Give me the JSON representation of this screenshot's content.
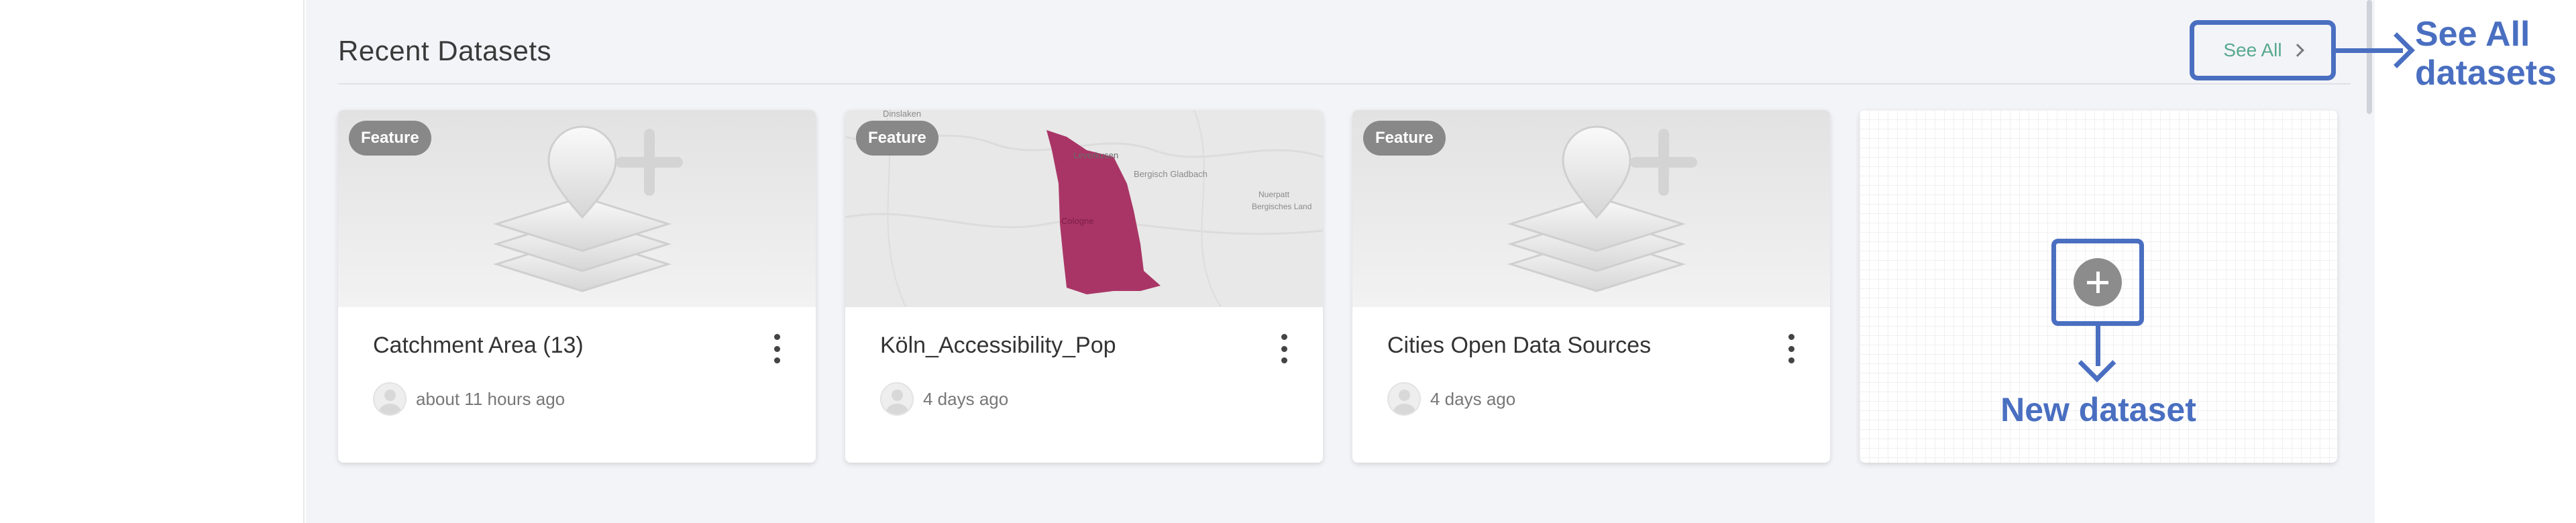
{
  "section": {
    "title": "Recent Datasets"
  },
  "see_all": {
    "label": "See All"
  },
  "cards": [
    {
      "badge": "Feature",
      "name": "Catchment Area (13)",
      "time": "about 11 hours ago",
      "thumbnail": "layers-plus-icon"
    },
    {
      "badge": "Feature",
      "name": "Köln_Accessibility_Pop",
      "time": "4 days ago",
      "thumbnail": "map-preview",
      "map_labels": [
        "Dinslaken",
        "Leverkusen",
        "Bergisch Gladbach",
        "Cologne",
        "Nuerpatt",
        "Bergisches Land"
      ]
    },
    {
      "badge": "Feature",
      "name": "Cities Open Data Sources",
      "time": "4 days ago",
      "thumbnail": "layers-plus-icon"
    }
  ],
  "new_dataset": {
    "label": "New dataset"
  },
  "annotations": {
    "see_all_callout_line1": "See All",
    "see_all_callout_line2": "datasets"
  },
  "colors": {
    "accent_blue": "#4a6fc1",
    "link_green": "#58a98d",
    "map_polygon": "#a93566",
    "badge_gray": "#888888"
  }
}
